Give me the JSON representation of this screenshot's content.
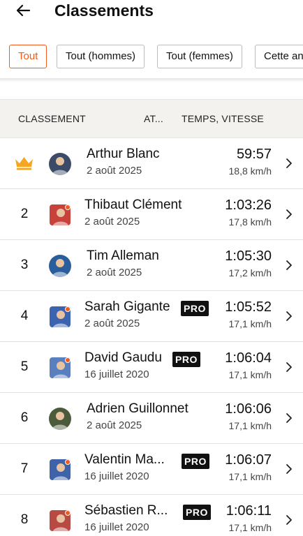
{
  "header": {
    "title": "Classements"
  },
  "filters": [
    {
      "label": "Tout",
      "active": true
    },
    {
      "label": "Tout (hommes)",
      "active": false
    },
    {
      "label": "Tout (femmes)",
      "active": false
    },
    {
      "label": "Cette ann",
      "active": false
    }
  ],
  "ghost_title": "Arthur Blanc",
  "table_header": {
    "rank": "CLASSEMENT",
    "athlete": "AT...",
    "time": "TEMPS, VITESSE"
  },
  "leaderboard": [
    {
      "rank": "",
      "crown": true,
      "name": "Arthur Blanc",
      "date": "2 août 2025",
      "pro": false,
      "pro_label": "",
      "time": "59:57",
      "speed": "18,8 km/h",
      "avatar_color": "#3b4a66"
    },
    {
      "rank": "2",
      "crown": false,
      "name": "Thibaut Clément",
      "date": "2 août 2025",
      "pro": false,
      "pro_label": "",
      "time": "1:03:26",
      "speed": "17,8 km/h",
      "avatar_color": "#c9413b"
    },
    {
      "rank": "3",
      "crown": false,
      "name": "Tim Alleman",
      "date": "2 août 2025",
      "pro": false,
      "pro_label": "",
      "time": "1:05:30",
      "speed": "17,2 km/h",
      "avatar_color": "#2a5d9c"
    },
    {
      "rank": "4",
      "crown": false,
      "name": "Sarah Gigante",
      "date": "2 août 2025",
      "pro": true,
      "pro_label": "PRO",
      "time": "1:05:52",
      "speed": "17,1 km/h",
      "avatar_color": "#3c63b0"
    },
    {
      "rank": "5",
      "crown": false,
      "name": "David Gaudu",
      "date": "16 juillet 2020",
      "pro": true,
      "pro_label": "PRO",
      "time": "1:06:04",
      "speed": "17,1 km/h",
      "avatar_color": "#5a7fbf"
    },
    {
      "rank": "6",
      "crown": false,
      "name": "Adrien Guillonnet",
      "date": "2 août 2025",
      "pro": false,
      "pro_label": "",
      "time": "1:06:06",
      "speed": "17,1 km/h",
      "avatar_color": "#4b5a3a"
    },
    {
      "rank": "7",
      "crown": false,
      "name": "Valentin Ma...",
      "date": "16 juillet 2020",
      "pro": true,
      "pro_label": "PRO",
      "time": "1:06:07",
      "speed": "17,1 km/h",
      "avatar_color": "#3f63a8"
    },
    {
      "rank": "8",
      "crown": false,
      "name": "Sébastien R...",
      "date": "16 juillet 2020",
      "pro": true,
      "pro_label": "PRO",
      "time": "1:06:11",
      "speed": "17,1 km/h",
      "avatar_color": "#b84a44"
    }
  ],
  "colors": {
    "accent": "#f05a1a",
    "crown": "#f5a623",
    "header_bg": "#f3f2ef"
  }
}
